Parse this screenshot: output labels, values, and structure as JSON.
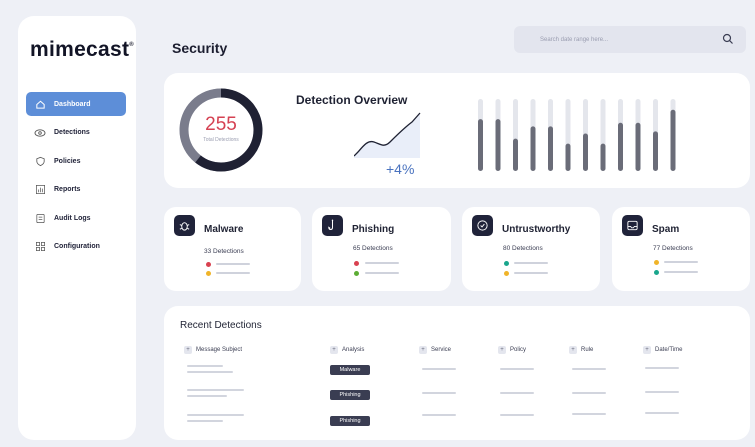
{
  "sidebar": {
    "logo": "mimecast",
    "logo_mark": "®",
    "items": [
      {
        "label": "Dashboard",
        "icon": "home-icon",
        "active": true
      },
      {
        "label": "Detections",
        "icon": "eye-icon",
        "active": false
      },
      {
        "label": "Policies",
        "icon": "shield-icon",
        "active": false
      },
      {
        "label": "Reports",
        "icon": "bar-chart-icon",
        "active": false
      },
      {
        "label": "Audit Logs",
        "icon": "document-icon",
        "active": false
      },
      {
        "label": "Configuration",
        "icon": "grid-icon",
        "active": false
      }
    ]
  },
  "header": {
    "title": "Security",
    "search_placeholder": "Search date range here..."
  },
  "overview": {
    "total_value": "255",
    "total_label": "Total Detections",
    "title": "Detection Overview",
    "trend_value": "+4%",
    "bar_levels": [
      0.72,
      0.72,
      0.45,
      0.62,
      0.62,
      0.38,
      0.52,
      0.38,
      0.67,
      0.67,
      0.55,
      0.85
    ]
  },
  "categories": [
    {
      "name": "Malware",
      "count": "33 Detections",
      "icon": "bug-icon",
      "dots": [
        "#d94150",
        "#f0b429"
      ]
    },
    {
      "name": "Phishing",
      "count": "65 Detections",
      "icon": "fishing-hook-icon",
      "dots": [
        "#d94150",
        "#5cad34"
      ]
    },
    {
      "name": "Untrustworthy",
      "count": "80 Detections",
      "icon": "badge-icon",
      "dots": [
        "#1aa68c",
        "#f0b429"
      ]
    },
    {
      "name": "Spam",
      "count": "77 Detections",
      "icon": "inbox-icon",
      "dots": [
        "#f0b429",
        "#1aa68c"
      ]
    }
  ],
  "recent": {
    "title": "Recent Detections",
    "columns": [
      "Message Subject",
      "Analysis",
      "Service",
      "Policy",
      "Rule",
      "Date/Time"
    ],
    "rows": [
      {
        "analysis": "Malware"
      },
      {
        "analysis": "Phishing"
      },
      {
        "analysis": "Phishing"
      }
    ]
  },
  "colors": {
    "accent": "#5d8ed8",
    "donut_dark": "#1f2133",
    "donut_mid": "#7a7c8c",
    "donut_light": "#d4d6de",
    "alert_red": "#d54152",
    "trend_blue": "#4a73bf"
  }
}
